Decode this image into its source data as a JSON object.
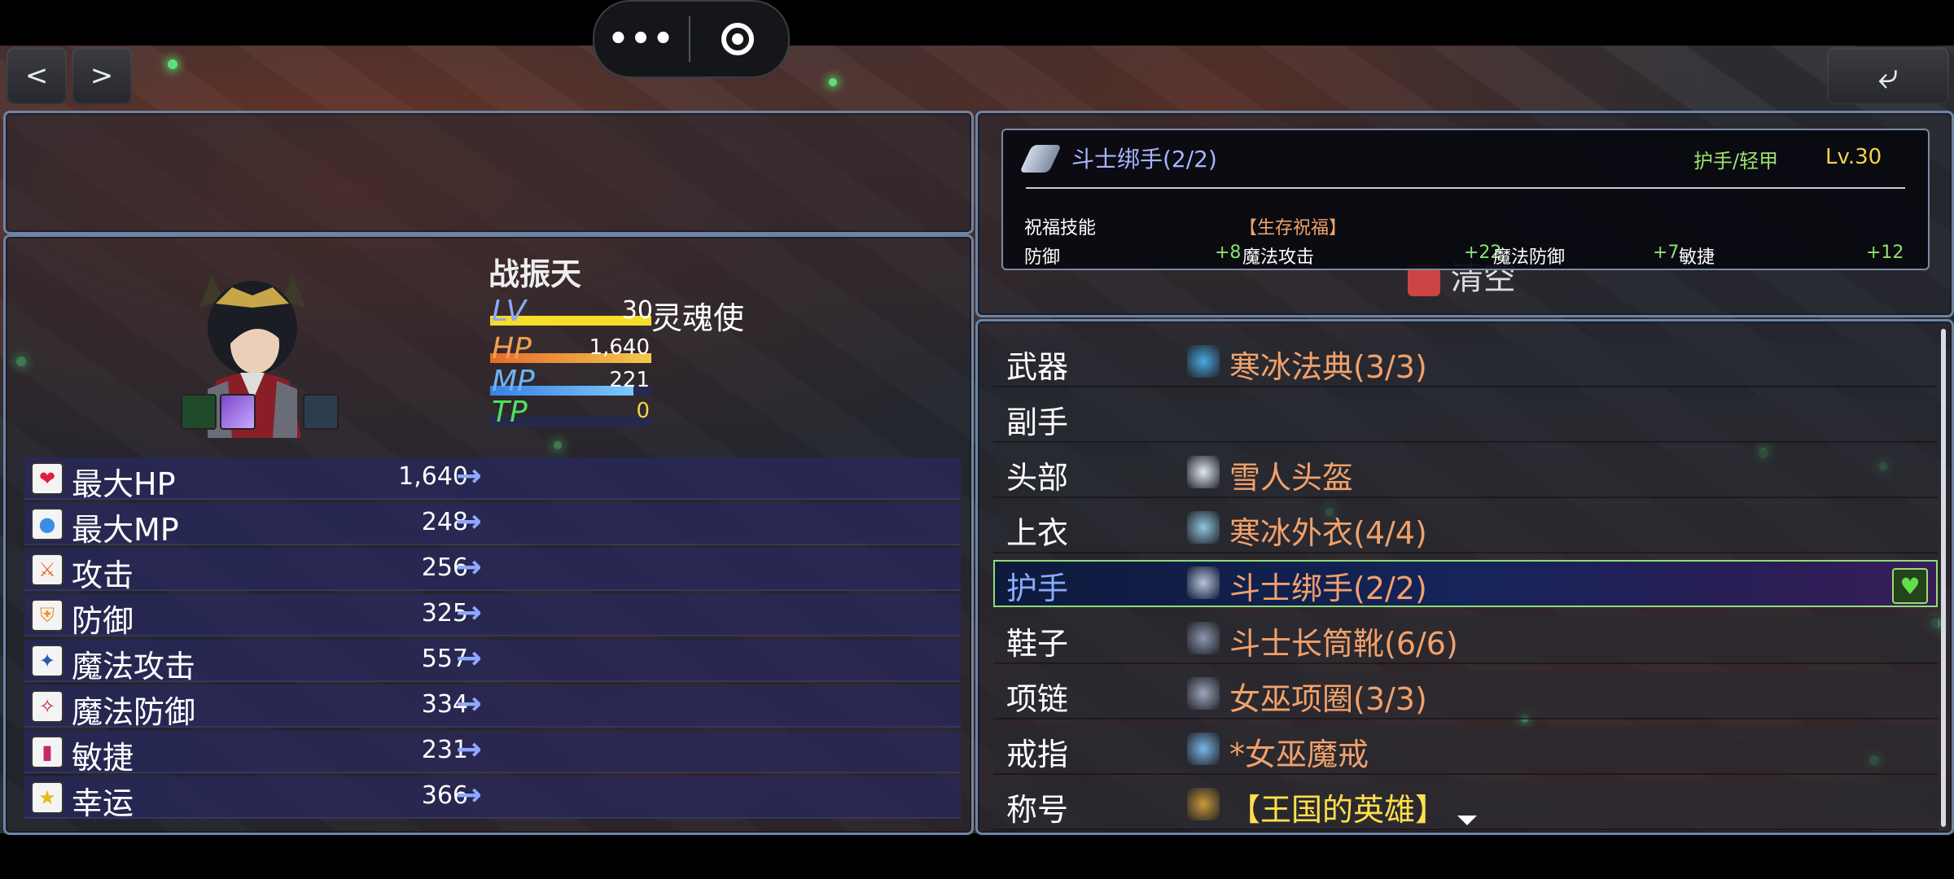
{
  "nav": {
    "back": "<",
    "forward": ">",
    "return": "⤶"
  },
  "capsule": {
    "more": "•••"
  },
  "character": {
    "name": "战振天",
    "lv_label": "LV",
    "lv": "30",
    "class": "灵魂使",
    "hp_label": "HP",
    "hp": "1,640",
    "mp_label": "MP",
    "mp": "221",
    "tp_label": "TP",
    "tp": "0",
    "gauges": {
      "hp": 1.0,
      "mp": 0.89,
      "tp": 0.0
    }
  },
  "stats": [
    {
      "label": "最大HP",
      "value": "1,640",
      "icon": "heart-icon",
      "arrow": "→"
    },
    {
      "label": "最大MP",
      "value": "248",
      "icon": "mana-orb-icon",
      "arrow": "→"
    },
    {
      "label": "攻击",
      "value": "256",
      "icon": "sword-icon",
      "arrow": "→"
    },
    {
      "label": "防御",
      "value": "325",
      "icon": "shield-icon",
      "arrow": "→"
    },
    {
      "label": "魔法攻击",
      "value": "557",
      "icon": "staff-icon",
      "arrow": "→"
    },
    {
      "label": "魔法防御",
      "value": "334",
      "icon": "magic-shield-icon",
      "arrow": "→"
    },
    {
      "label": "敏捷",
      "value": "231",
      "icon": "boot-icon",
      "arrow": "→"
    },
    {
      "label": "幸运",
      "value": "366",
      "icon": "star-icon",
      "arrow": "→"
    }
  ],
  "equipment": [
    {
      "slot": "武器",
      "item": "寒冰法典(3/3)",
      "icon": "ice-tome-icon"
    },
    {
      "slot": "副手",
      "item": "",
      "icon": ""
    },
    {
      "slot": "头部",
      "item": "雪人头盔",
      "icon": "snowman-helmet-icon"
    },
    {
      "slot": "上衣",
      "item": "寒冰外衣(4/4)",
      "icon": "ice-coat-icon"
    },
    {
      "slot": "护手",
      "item": "斗士绑手(2/2)",
      "icon": "gauntlet-icon",
      "selected": true
    },
    {
      "slot": "鞋子",
      "item": "斗士长筒靴(6/6)",
      "icon": "boots-icon"
    },
    {
      "slot": "项链",
      "item": "女巫项圈(3/3)",
      "icon": "necklace-icon"
    },
    {
      "slot": "戒指",
      "item": "*女巫魔戒",
      "icon": "ring-icon"
    },
    {
      "slot": "称号",
      "item": "【王国的英雄】",
      "icon": "medal-icon"
    }
  ],
  "hidden_button_text": "清空",
  "tooltip": {
    "name": "斗士绑手(2/2)",
    "type": "护手/轻甲",
    "level": "Lv.30",
    "blessing_label": "祝福技能",
    "blessing": "【生存祝福】",
    "bonuses": [
      {
        "stat": "防御",
        "value": "+8"
      },
      {
        "stat": "魔法攻击",
        "value": "+22"
      },
      {
        "stat": "魔法防御",
        "value": "+7"
      },
      {
        "stat": "敏捷",
        "value": "+12"
      }
    ]
  },
  "colors": {
    "panel_border": "#6d84a6",
    "item_text": "#f0a16b",
    "selected_slot": "#8ba9ff",
    "tooltip_name": "#a8b4ff",
    "tooltip_type": "#9be36d",
    "tooltip_level": "#f2d24a",
    "blessing": "#f0a16b",
    "bonus_value": "#8be36d",
    "title_item": "#ffe04a"
  }
}
